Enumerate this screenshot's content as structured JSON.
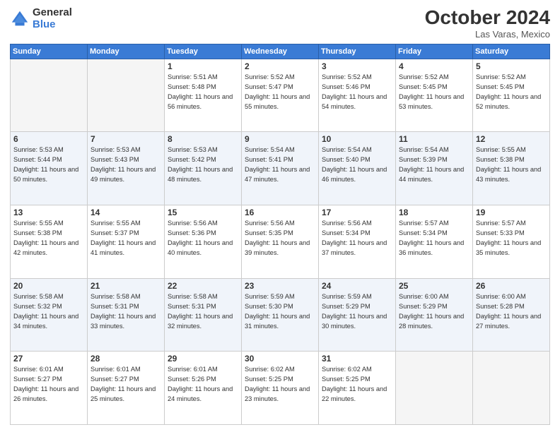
{
  "header": {
    "logo_general": "General",
    "logo_blue": "Blue",
    "month_title": "October 2024",
    "location": "Las Varas, Mexico"
  },
  "days_of_week": [
    "Sunday",
    "Monday",
    "Tuesday",
    "Wednesday",
    "Thursday",
    "Friday",
    "Saturday"
  ],
  "weeks": [
    [
      {
        "day": "",
        "empty": true
      },
      {
        "day": "",
        "empty": true
      },
      {
        "day": "1",
        "sunrise": "Sunrise: 5:51 AM",
        "sunset": "Sunset: 5:48 PM",
        "daylight": "Daylight: 11 hours and 56 minutes."
      },
      {
        "day": "2",
        "sunrise": "Sunrise: 5:52 AM",
        "sunset": "Sunset: 5:47 PM",
        "daylight": "Daylight: 11 hours and 55 minutes."
      },
      {
        "day": "3",
        "sunrise": "Sunrise: 5:52 AM",
        "sunset": "Sunset: 5:46 PM",
        "daylight": "Daylight: 11 hours and 54 minutes."
      },
      {
        "day": "4",
        "sunrise": "Sunrise: 5:52 AM",
        "sunset": "Sunset: 5:45 PM",
        "daylight": "Daylight: 11 hours and 53 minutes."
      },
      {
        "day": "5",
        "sunrise": "Sunrise: 5:52 AM",
        "sunset": "Sunset: 5:45 PM",
        "daylight": "Daylight: 11 hours and 52 minutes."
      }
    ],
    [
      {
        "day": "6",
        "sunrise": "Sunrise: 5:53 AM",
        "sunset": "Sunset: 5:44 PM",
        "daylight": "Daylight: 11 hours and 50 minutes."
      },
      {
        "day": "7",
        "sunrise": "Sunrise: 5:53 AM",
        "sunset": "Sunset: 5:43 PM",
        "daylight": "Daylight: 11 hours and 49 minutes."
      },
      {
        "day": "8",
        "sunrise": "Sunrise: 5:53 AM",
        "sunset": "Sunset: 5:42 PM",
        "daylight": "Daylight: 11 hours and 48 minutes."
      },
      {
        "day": "9",
        "sunrise": "Sunrise: 5:54 AM",
        "sunset": "Sunset: 5:41 PM",
        "daylight": "Daylight: 11 hours and 47 minutes."
      },
      {
        "day": "10",
        "sunrise": "Sunrise: 5:54 AM",
        "sunset": "Sunset: 5:40 PM",
        "daylight": "Daylight: 11 hours and 46 minutes."
      },
      {
        "day": "11",
        "sunrise": "Sunrise: 5:54 AM",
        "sunset": "Sunset: 5:39 PM",
        "daylight": "Daylight: 11 hours and 44 minutes."
      },
      {
        "day": "12",
        "sunrise": "Sunrise: 5:55 AM",
        "sunset": "Sunset: 5:38 PM",
        "daylight": "Daylight: 11 hours and 43 minutes."
      }
    ],
    [
      {
        "day": "13",
        "sunrise": "Sunrise: 5:55 AM",
        "sunset": "Sunset: 5:38 PM",
        "daylight": "Daylight: 11 hours and 42 minutes."
      },
      {
        "day": "14",
        "sunrise": "Sunrise: 5:55 AM",
        "sunset": "Sunset: 5:37 PM",
        "daylight": "Daylight: 11 hours and 41 minutes."
      },
      {
        "day": "15",
        "sunrise": "Sunrise: 5:56 AM",
        "sunset": "Sunset: 5:36 PM",
        "daylight": "Daylight: 11 hours and 40 minutes."
      },
      {
        "day": "16",
        "sunrise": "Sunrise: 5:56 AM",
        "sunset": "Sunset: 5:35 PM",
        "daylight": "Daylight: 11 hours and 39 minutes."
      },
      {
        "day": "17",
        "sunrise": "Sunrise: 5:56 AM",
        "sunset": "Sunset: 5:34 PM",
        "daylight": "Daylight: 11 hours and 37 minutes."
      },
      {
        "day": "18",
        "sunrise": "Sunrise: 5:57 AM",
        "sunset": "Sunset: 5:34 PM",
        "daylight": "Daylight: 11 hours and 36 minutes."
      },
      {
        "day": "19",
        "sunrise": "Sunrise: 5:57 AM",
        "sunset": "Sunset: 5:33 PM",
        "daylight": "Daylight: 11 hours and 35 minutes."
      }
    ],
    [
      {
        "day": "20",
        "sunrise": "Sunrise: 5:58 AM",
        "sunset": "Sunset: 5:32 PM",
        "daylight": "Daylight: 11 hours and 34 minutes."
      },
      {
        "day": "21",
        "sunrise": "Sunrise: 5:58 AM",
        "sunset": "Sunset: 5:31 PM",
        "daylight": "Daylight: 11 hours and 33 minutes."
      },
      {
        "day": "22",
        "sunrise": "Sunrise: 5:58 AM",
        "sunset": "Sunset: 5:31 PM",
        "daylight": "Daylight: 11 hours and 32 minutes."
      },
      {
        "day": "23",
        "sunrise": "Sunrise: 5:59 AM",
        "sunset": "Sunset: 5:30 PM",
        "daylight": "Daylight: 11 hours and 31 minutes."
      },
      {
        "day": "24",
        "sunrise": "Sunrise: 5:59 AM",
        "sunset": "Sunset: 5:29 PM",
        "daylight": "Daylight: 11 hours and 30 minutes."
      },
      {
        "day": "25",
        "sunrise": "Sunrise: 6:00 AM",
        "sunset": "Sunset: 5:29 PM",
        "daylight": "Daylight: 11 hours and 28 minutes."
      },
      {
        "day": "26",
        "sunrise": "Sunrise: 6:00 AM",
        "sunset": "Sunset: 5:28 PM",
        "daylight": "Daylight: 11 hours and 27 minutes."
      }
    ],
    [
      {
        "day": "27",
        "sunrise": "Sunrise: 6:01 AM",
        "sunset": "Sunset: 5:27 PM",
        "daylight": "Daylight: 11 hours and 26 minutes."
      },
      {
        "day": "28",
        "sunrise": "Sunrise: 6:01 AM",
        "sunset": "Sunset: 5:27 PM",
        "daylight": "Daylight: 11 hours and 25 minutes."
      },
      {
        "day": "29",
        "sunrise": "Sunrise: 6:01 AM",
        "sunset": "Sunset: 5:26 PM",
        "daylight": "Daylight: 11 hours and 24 minutes."
      },
      {
        "day": "30",
        "sunrise": "Sunrise: 6:02 AM",
        "sunset": "Sunset: 5:25 PM",
        "daylight": "Daylight: 11 hours and 23 minutes."
      },
      {
        "day": "31",
        "sunrise": "Sunrise: 6:02 AM",
        "sunset": "Sunset: 5:25 PM",
        "daylight": "Daylight: 11 hours and 22 minutes."
      },
      {
        "day": "",
        "empty": true
      },
      {
        "day": "",
        "empty": true
      }
    ]
  ]
}
